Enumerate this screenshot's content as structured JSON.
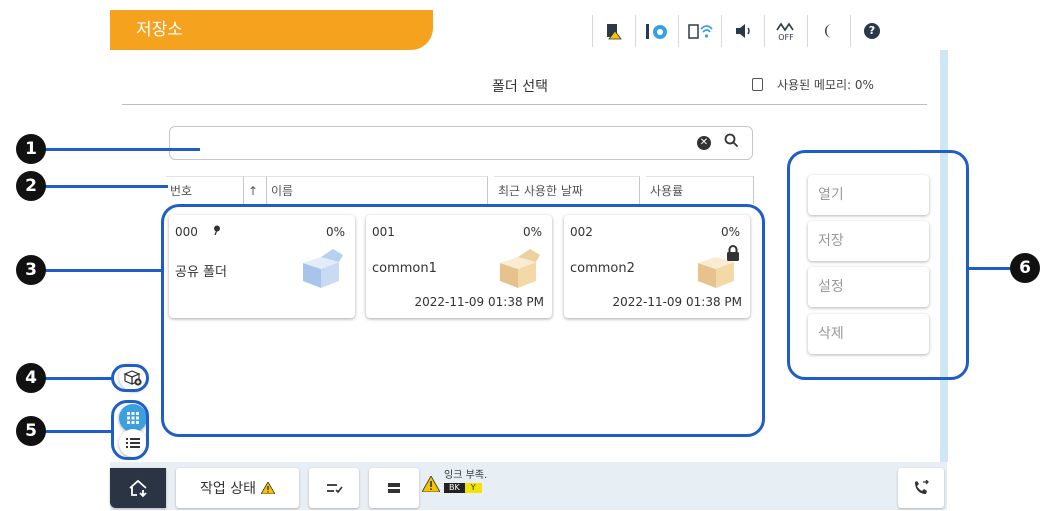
{
  "app": {
    "tab_title": "저장소"
  },
  "status_icons": [
    "paper-warning-icon",
    "info-icon",
    "wifi-icon",
    "volume-icon",
    "fax-off-icon",
    "sleep-icon",
    "help-icon"
  ],
  "status_texts": {
    "fax_off": "OFF",
    "help": "?"
  },
  "header": {
    "title": "폴더 선택",
    "memory_label": "사용된 메모리: 0%"
  },
  "search": {
    "value": "",
    "placeholder": "",
    "clear_symbol": "✕",
    "search_symbol": "⚲"
  },
  "columns": [
    {
      "label": "번호"
    },
    {
      "label": "↑"
    },
    {
      "label": "이름"
    },
    {
      "label": "최근 사용한 날짜"
    },
    {
      "label": "사용률"
    }
  ],
  "folders": [
    {
      "number": "000",
      "usage": "0%",
      "name": "공유 폴더",
      "date": "",
      "locked": false,
      "pinned": true
    },
    {
      "number": "001",
      "usage": "0%",
      "name": "common1",
      "date": "2022-11-09 01:38 PM",
      "locked": false,
      "pinned": false
    },
    {
      "number": "002",
      "usage": "0%",
      "name": "common2",
      "date": "2022-11-09 01:38 PM",
      "locked": true,
      "pinned": false
    }
  ],
  "actions": {
    "open": "열기",
    "save": "저장",
    "settings": "설정",
    "delete": "삭제"
  },
  "bottom": {
    "job_status": "작업 상태",
    "ink_warning": "잉크 부족.",
    "ink_bk": "BK",
    "ink_y": "Y"
  },
  "callouts": [
    "1",
    "2",
    "3",
    "4",
    "5",
    "6"
  ],
  "colors": {
    "accent": "#f5a21e",
    "callout_blue": "#1f5ec8",
    "view_active": "#3aa0e0"
  }
}
